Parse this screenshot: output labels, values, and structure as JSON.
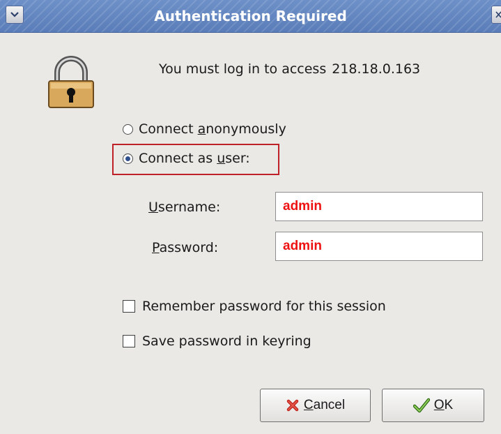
{
  "window": {
    "title": "Authentication Required",
    "menu_icon": "chevron-down-icon",
    "close_icon": "close-icon"
  },
  "dialog": {
    "message": "You must log in to access",
    "host": "218.18.0.163",
    "icon": "padlock-icon"
  },
  "connection": {
    "anonymous": {
      "pre": "Connect ",
      "key": "a",
      "post": "nonymously",
      "selected": false
    },
    "as_user": {
      "pre": "Connect as ",
      "key": "u",
      "post": "ser:",
      "selected": true
    },
    "highlight_color": "#bf2128"
  },
  "fields": {
    "username": {
      "key": "U",
      "rest": "sername:",
      "value": "admin"
    },
    "password": {
      "key": "P",
      "rest": "assword:",
      "value": "admin"
    },
    "value_color": "#ee1111"
  },
  "options": {
    "remember": {
      "label": "Remember password for this session",
      "checked": false
    },
    "keyring": {
      "label": "Save password in keyring",
      "checked": false
    }
  },
  "buttons": {
    "cancel": {
      "key": "C",
      "rest": "ancel",
      "icon": "cancel-x-icon"
    },
    "ok": {
      "key": "O",
      "rest": "K",
      "icon": "checkmark-icon"
    }
  },
  "colors": {
    "titlebar": "#5a7db9",
    "dialog_bg": "#eae9e6"
  }
}
